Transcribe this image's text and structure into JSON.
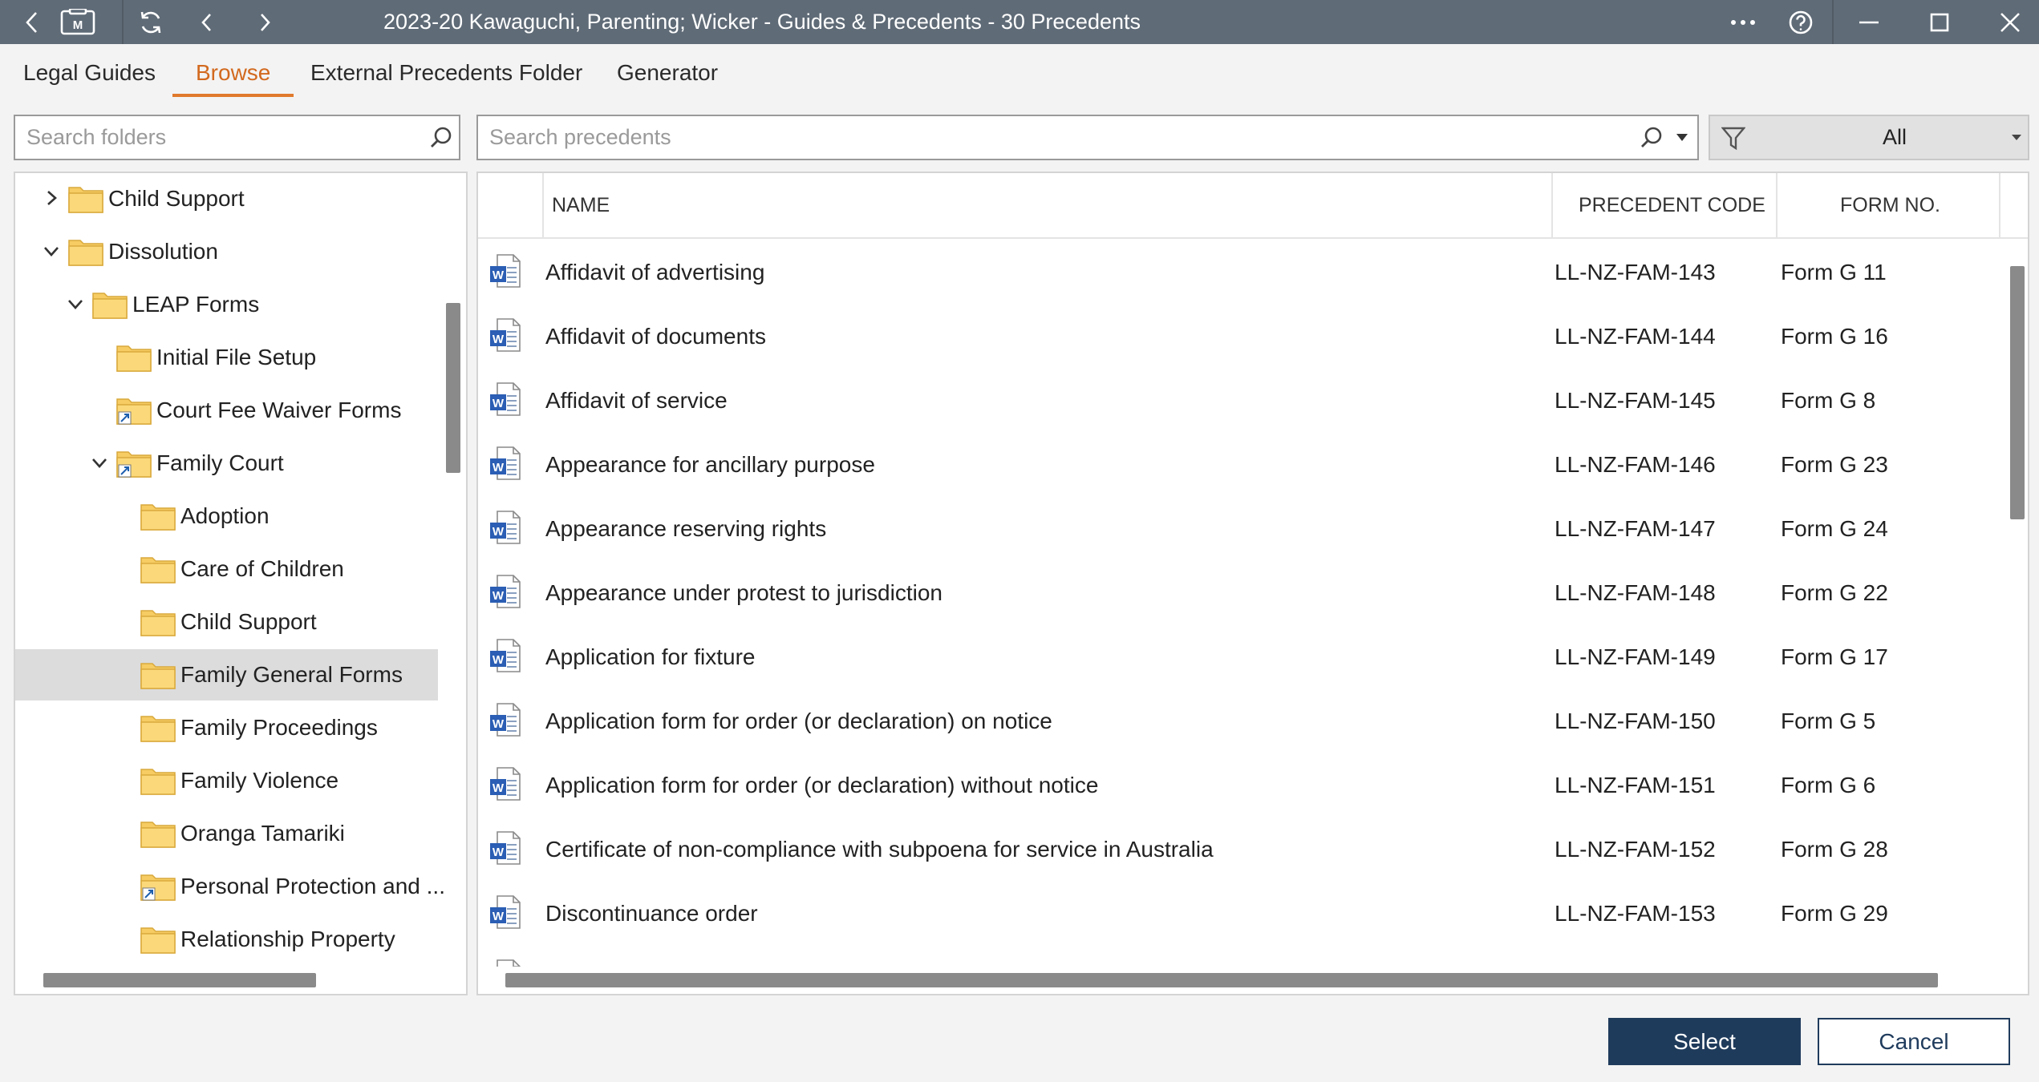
{
  "window": {
    "title": "2023-20 Kawaguchi, Parenting; Wicker - Guides & Precedents - 30 Precedents"
  },
  "tabs": [
    {
      "label": "Legal Guides"
    },
    {
      "label": "Browse"
    },
    {
      "label": "External Precedents Folder"
    },
    {
      "label": "Generator"
    }
  ],
  "folder_search": {
    "placeholder": "Search folders"
  },
  "precedent_search": {
    "placeholder": "Search precedents"
  },
  "filter": {
    "value": "All"
  },
  "tree": [
    {
      "label": "Child Support"
    },
    {
      "label": "Dissolution"
    },
    {
      "label": "LEAP Forms"
    },
    {
      "label": "Initial File Setup"
    },
    {
      "label": "Court Fee Waiver Forms"
    },
    {
      "label": "Family Court"
    },
    {
      "label": "Adoption"
    },
    {
      "label": "Care of Children"
    },
    {
      "label": "Child Support"
    },
    {
      "label": "Family General Forms"
    },
    {
      "label": "Family Proceedings"
    },
    {
      "label": "Family Violence"
    },
    {
      "label": "Oranga Tamariki"
    },
    {
      "label": "Personal Protection and ..."
    },
    {
      "label": "Relationship Property"
    }
  ],
  "columns": {
    "name": "NAME",
    "code": "PRECEDENT CODE",
    "form": "FORM NO."
  },
  "precedents": [
    {
      "name": "Affidavit of advertising",
      "code": "LL-NZ-FAM-143",
      "form": "Form G 11"
    },
    {
      "name": "Affidavit of documents",
      "code": "LL-NZ-FAM-144",
      "form": "Form G 16"
    },
    {
      "name": "Affidavit of service",
      "code": "LL-NZ-FAM-145",
      "form": "Form G 8"
    },
    {
      "name": "Appearance for ancillary purpose",
      "code": "LL-NZ-FAM-146",
      "form": "Form G 23"
    },
    {
      "name": "Appearance reserving rights",
      "code": "LL-NZ-FAM-147",
      "form": "Form G 24"
    },
    {
      "name": "Appearance under protest to jurisdiction",
      "code": "LL-NZ-FAM-148",
      "form": "Form G 22"
    },
    {
      "name": "Application for fixture",
      "code": "LL-NZ-FAM-149",
      "form": "Form G 17"
    },
    {
      "name": "Application form for order (or declaration) on notice",
      "code": "LL-NZ-FAM-150",
      "form": "Form G 5"
    },
    {
      "name": "Application form for order (or declaration) without notice",
      "code": "LL-NZ-FAM-151",
      "form": "Form G 6"
    },
    {
      "name": "Certificate of non-compliance with subpoena for service in Australia",
      "code": "LL-NZ-FAM-152",
      "form": "Form G 28"
    },
    {
      "name": "Discontinuance order",
      "code": "LL-NZ-FAM-153",
      "form": "Form G 29"
    }
  ],
  "buttons": {
    "select": "Select",
    "cancel": "Cancel"
  }
}
